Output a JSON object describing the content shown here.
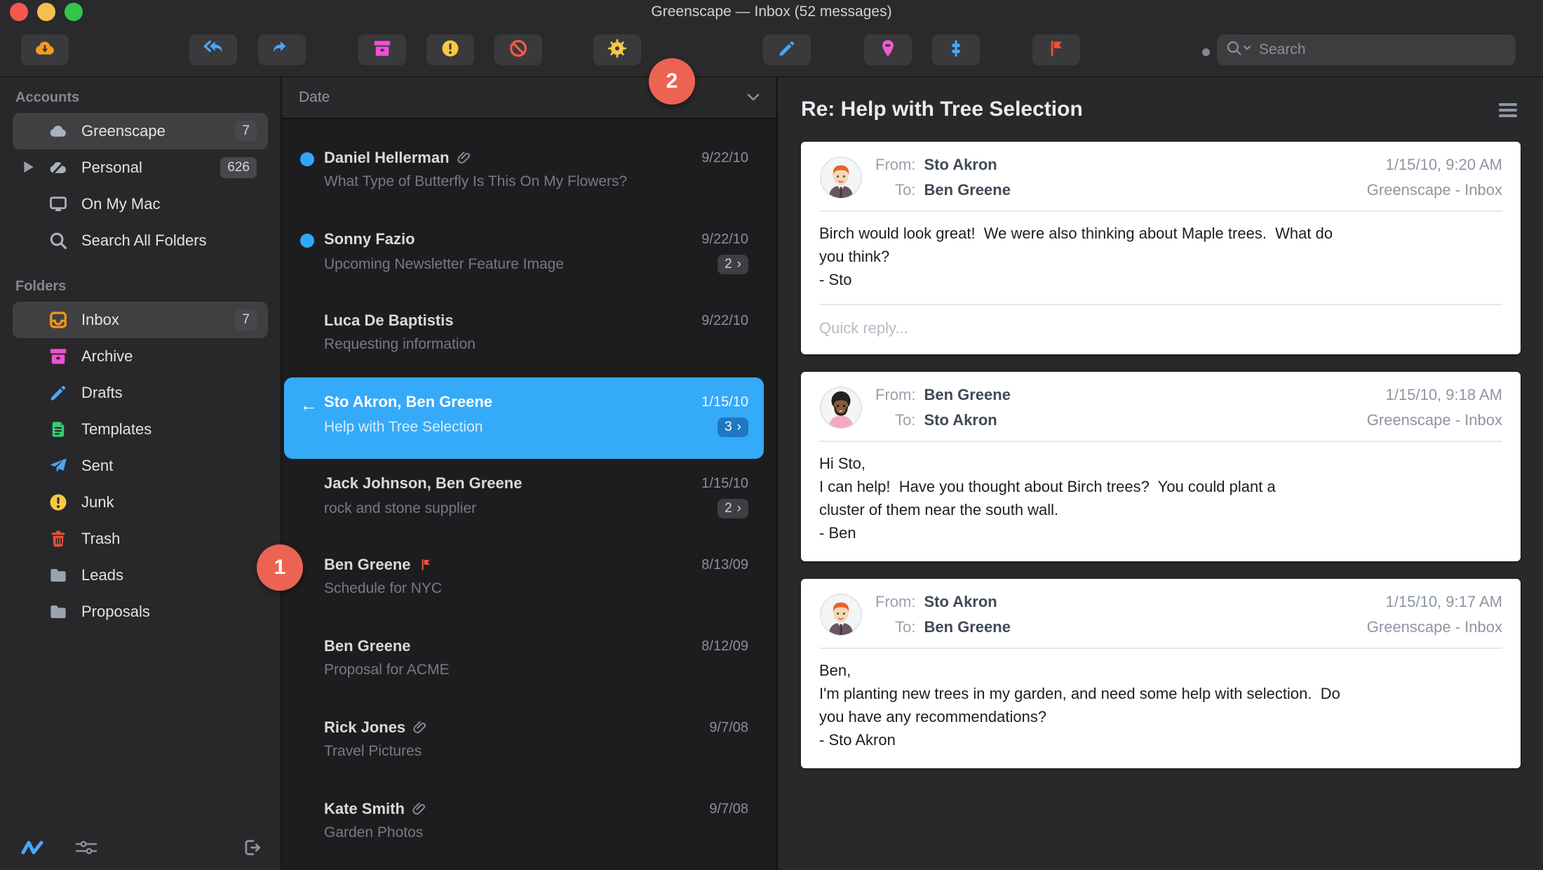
{
  "window": {
    "title": "Greenscape — Inbox (52 messages)"
  },
  "toolbar": {
    "search_placeholder": "Search"
  },
  "sidebar": {
    "accounts_label": "Accounts",
    "accounts": [
      {
        "label": "Greenscape",
        "badge": "7"
      },
      {
        "label": "Personal",
        "badge": "626"
      },
      {
        "label": "On My Mac",
        "badge": ""
      },
      {
        "label": "Search All Folders",
        "badge": ""
      }
    ],
    "folders_label": "Folders",
    "folders": [
      {
        "label": "Inbox",
        "badge": "7"
      },
      {
        "label": "Archive"
      },
      {
        "label": "Drafts"
      },
      {
        "label": "Templates"
      },
      {
        "label": "Sent"
      },
      {
        "label": "Junk"
      },
      {
        "label": "Trash"
      },
      {
        "label": "Leads"
      },
      {
        "label": "Proposals"
      }
    ]
  },
  "message_list": {
    "sort_label": "Date",
    "selected_arrow": "←",
    "thread_chevron": "›",
    "messages": [
      {
        "from": "Daniel Hellerman",
        "subject": "What Type of Butterfly Is This On My Flowers?",
        "date": "9/22/10"
      },
      {
        "from": "Sonny Fazio",
        "subject": "Upcoming Newsletter Feature Image",
        "date": "9/22/10",
        "thread": "2"
      },
      {
        "from": "Luca De Baptistis",
        "subject": "Requesting information",
        "date": "9/22/10"
      },
      {
        "from": "Sto Akron, Ben Greene",
        "subject": "Help with Tree Selection",
        "date": "1/15/10",
        "thread": "3"
      },
      {
        "from": "Jack Johnson, Ben Greene",
        "subject": "rock and stone supplier",
        "date": "1/15/10",
        "thread": "2"
      },
      {
        "from": "Ben Greene",
        "subject": "Schedule for NYC",
        "date": "8/13/09"
      },
      {
        "from": "Ben Greene",
        "subject": "Proposal for ACME",
        "date": "8/12/09"
      },
      {
        "from": "Rick Jones",
        "subject": "Travel Pictures",
        "date": "9/7/08"
      },
      {
        "from": "Kate Smith",
        "subject": "Garden Photos",
        "date": "9/7/08"
      }
    ]
  },
  "reading_pane": {
    "title": "Re: Help with Tree Selection",
    "messages": [
      {
        "from_label": "From:",
        "from": "Sto Akron",
        "to_label": "To:",
        "to": "Ben Greene",
        "datetime": "1/15/10, 9:20 AM",
        "folder": "Greenscape - Inbox",
        "body_lines": [
          "Birch would look great!  We were also thinking about Maple trees.  What do",
          "you think?",
          "- Sto"
        ],
        "quick_reply_placeholder": "Quick reply..."
      },
      {
        "from_label": "From:",
        "from": "Ben Greene",
        "to_label": "To:",
        "to": "Sto Akron",
        "datetime": "1/15/10, 9:18 AM",
        "folder": "Greenscape - Inbox",
        "body_lines": [
          "Hi Sto,",
          "I can help!  Have you thought about Birch trees?  You could plant a",
          "cluster of them near the south wall.",
          "- Ben"
        ]
      },
      {
        "from_label": "From:",
        "from": "Sto Akron",
        "to_label": "To:",
        "to": "Ben Greene",
        "datetime": "1/15/10, 9:17 AM",
        "folder": "Greenscape - Inbox",
        "body_lines": [
          "Ben,",
          "I'm planting new trees in my garden, and need some help with selection.  Do",
          "you have any recommendations?",
          "- Sto Akron"
        ]
      }
    ]
  },
  "annotations": {
    "step1": "1",
    "step2": "2"
  },
  "colors": {
    "accent_blue": "#35aaf8",
    "unread_blue": "#2fa7f8",
    "callout_orange": "#ed6352",
    "flag_red": "#f05038",
    "inbox_orange": "#f5951d",
    "archive_pink": "#f04fd4",
    "junk_yellow": "#f6c844",
    "templates_green": "#35cd73",
    "card_white": "#ffffff"
  }
}
